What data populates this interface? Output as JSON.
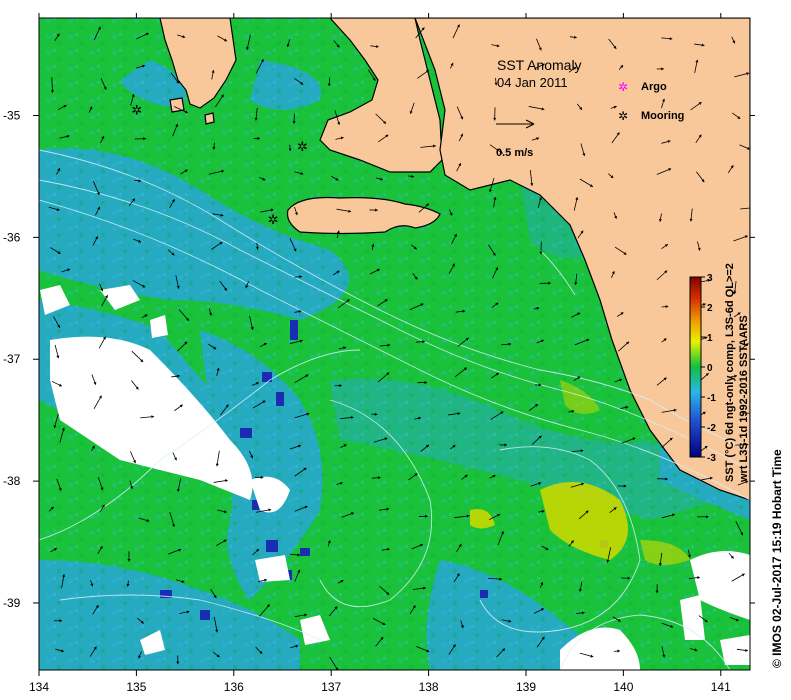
{
  "map": {
    "title": "SST Anomaly",
    "date": "04 Jan 2011",
    "speed_label": "0.5 m/s",
    "legend": {
      "argo": "Argo",
      "mooring": "Mooring",
      "argo_color": "#ff00ff",
      "mooring_color": "#000000"
    },
    "colorbar": {
      "ticks": [
        "3",
        "2",
        "1",
        "0",
        "-1",
        "-2",
        "-3"
      ],
      "label_line1": "SST (°C) 6d ngt-only comp, L3S-6d QL>=2",
      "label_line2": "wrt L3S-1d 1992-2016 SSTAARS"
    },
    "credit": "© IMOS 02-Jul-2017 15:19 Hobart Time",
    "axes": {
      "x_ticks": [
        "134",
        "135",
        "136",
        "137",
        "138",
        "139",
        "140",
        "141"
      ],
      "y_ticks": [
        "-35",
        "-36",
        "-37",
        "-38",
        "-39"
      ],
      "xlim": [
        134,
        141.3
      ],
      "ylim": [
        -39.55,
        -34.2
      ]
    },
    "colors": {
      "land": "#f9c89a",
      "ocean_anomaly": "#19c23a",
      "cool_anomaly": "#2aa6d8",
      "cold_anomaly": "#1a2cb0",
      "warm_anomaly": "#c8d800",
      "no_data": "#ffffff"
    },
    "moorings": [
      {
        "lon": 135.0,
        "lat": -34.95
      },
      {
        "lon": 136.7,
        "lat": -35.25
      },
      {
        "lon": 136.4,
        "lat": -35.85
      }
    ]
  }
}
